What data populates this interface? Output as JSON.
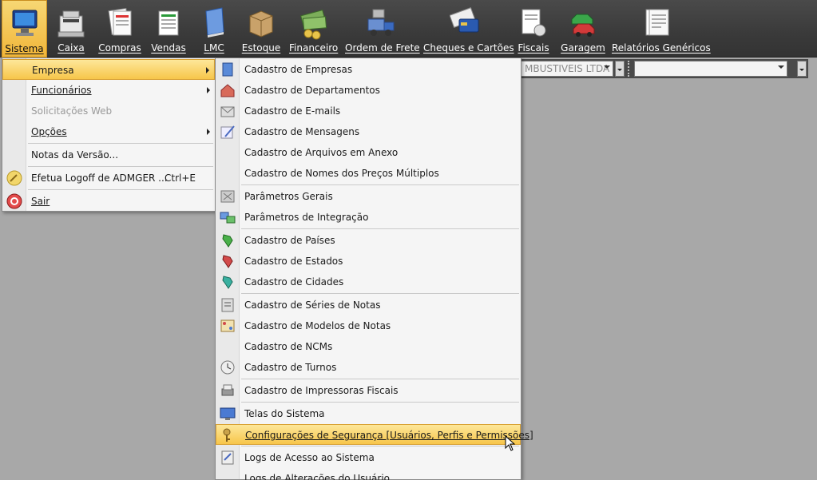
{
  "toolbar": {
    "items": [
      {
        "label": "Sistema",
        "icon": "computer-icon"
      },
      {
        "label": "Caixa",
        "icon": "cash-register-icon"
      },
      {
        "label": "Compras",
        "icon": "purchases-icon"
      },
      {
        "label": "Vendas",
        "icon": "sales-icon"
      },
      {
        "label": "LMC",
        "icon": "book-icon"
      },
      {
        "label": "Estoque",
        "icon": "box-icon"
      },
      {
        "label": "Financeiro",
        "icon": "money-icon"
      },
      {
        "label": "Ordem de Frete",
        "icon": "truck-icon"
      },
      {
        "label": "Cheques e Cartões",
        "icon": "cards-icon"
      },
      {
        "label": "Fiscais",
        "icon": "fiscal-icon"
      },
      {
        "label": "Garagem",
        "icon": "cars-icon"
      },
      {
        "label": "Relatórios Genéricos",
        "icon": "report-icon"
      }
    ]
  },
  "combo_bar": {
    "company_combo": "MBUSTIVEIS LTDA",
    "second_combo": ""
  },
  "sistema_menu": {
    "items": [
      {
        "label": "Empresa",
        "has_submenu": true,
        "highlighted": true
      },
      {
        "label": "Funcionários",
        "has_submenu": true
      },
      {
        "label": "Solicitações Web",
        "disabled": true
      },
      {
        "label": "Opções",
        "has_submenu": true
      },
      {
        "label": "Notas da Versão..."
      },
      {
        "label": "Efetua Logoff de ADMGER ...",
        "shortcut": "Ctrl+E",
        "icon": "key-icon"
      },
      {
        "label": "Sair",
        "icon": "exit-icon"
      }
    ]
  },
  "empresa_menu": {
    "items": [
      {
        "label": "Cadastro de Empresas",
        "icon": "building-icon"
      },
      {
        "label": "Cadastro de Departamentos",
        "icon": "department-icon"
      },
      {
        "label": "Cadastro de E-mails",
        "icon": "email-icon"
      },
      {
        "label": "Cadastro de Mensagens",
        "icon": "message-icon"
      },
      {
        "label": "Cadastro de Arquivos em Anexo"
      },
      {
        "label": "Cadastro de Nomes dos Preços Múltiplos"
      },
      {
        "label": "Parâmetros Gerais",
        "icon": "parameters-icon"
      },
      {
        "label": "Parâmetros de Integração",
        "icon": "integration-icon"
      },
      {
        "label": "Cadastro de Países",
        "icon": "country-icon"
      },
      {
        "label": "Cadastro de Estados",
        "icon": "state-icon"
      },
      {
        "label": "Cadastro de Cidades",
        "icon": "city-icon"
      },
      {
        "label": "Cadastro de Séries de Notas",
        "icon": "notes-series-icon"
      },
      {
        "label": "Cadastro de Modelos de Notas",
        "icon": "notes-model-icon"
      },
      {
        "label": "Cadastro de NCMs"
      },
      {
        "label": "Cadastro de Turnos",
        "icon": "clock-icon"
      },
      {
        "label": "Cadastro de Impressoras Fiscais",
        "icon": "printer-icon"
      },
      {
        "label": "Telas do Sistema",
        "icon": "screen-icon"
      },
      {
        "label": "Configurações de Segurança [Usuários, Perfis e Permissões]",
        "icon": "security-keys-icon",
        "highlighted": true
      },
      {
        "label": "Logs de Acesso ao Sistema",
        "icon": "log-icon"
      },
      {
        "label": "Logs de Alterações do Usuário"
      }
    ]
  },
  "colors": {
    "toolbar_bg": "#3a3a3a",
    "highlight": "#f7c64a",
    "workspace": "#a8a8a8"
  }
}
